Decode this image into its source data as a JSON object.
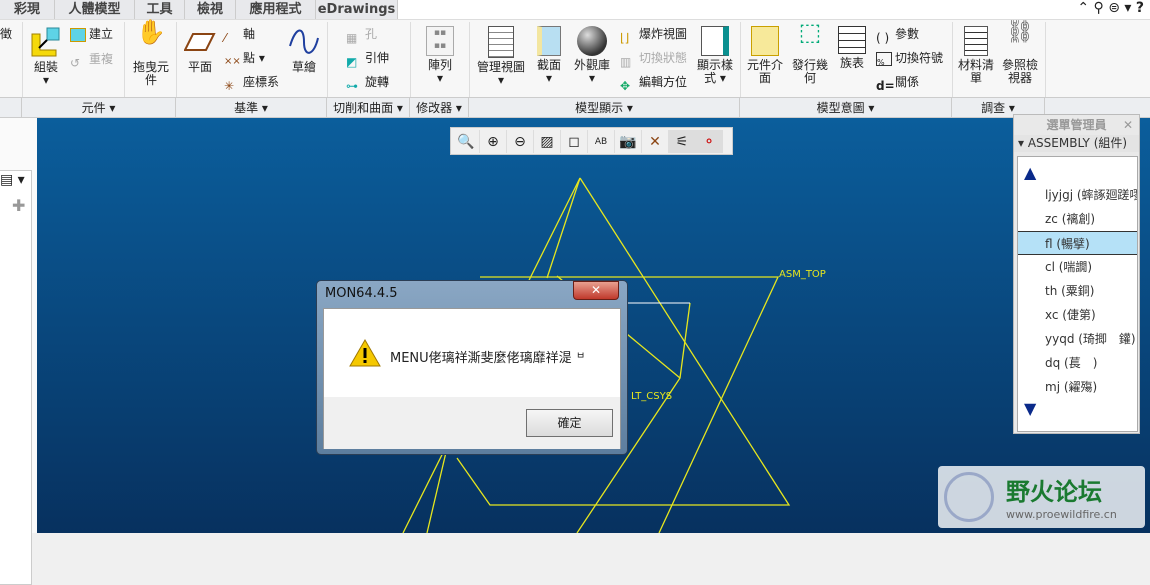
{
  "tabs": [
    "彩現",
    "人體模型",
    "工具",
    "檢視",
    "應用程式",
    "eDrawings"
  ],
  "partial_left_label": "徵",
  "ribbon": {
    "assemble": "組裝",
    "create": "建立",
    "repeat": "重複",
    "drag": "拖曳元件",
    "plane": "平面",
    "axis": "軸",
    "point": "點",
    "csys": "座標系",
    "sketch": "草繪",
    "hole": "孔",
    "extrude": "引伸",
    "revolve": "旋轉",
    "pattern": "陣列",
    "manage_views": "管理視圖",
    "section": "截面",
    "appearance": "外觀庫",
    "explode": "爆炸視圖",
    "toggle_status": "切換狀態",
    "edit_position": "編輯方位",
    "display_style": "顯示樣式",
    "component_interface": "元件介面",
    "publish_geometry": "發行幾何",
    "family_table": "族表",
    "parameters": "參數",
    "switch_symbols": "切換符號",
    "relations": "關係",
    "bom": "材料清單",
    "reference_viewer": "參照檢視器"
  },
  "groups": [
    "元件",
    "基準",
    "切削和曲面",
    "修改器",
    "模型顯示",
    "模型意圖",
    "調查"
  ],
  "graphics": {
    "labels": [
      "ASM_TOP",
      "LT_CSYS"
    ],
    "line_color": "#e6e61e"
  },
  "dialog": {
    "title": "MON64.4.5",
    "message": "MENU佬璃祥澌斐麼佬璃靡祥湜",
    "suffix": "ㅂ",
    "ok": "確定"
  },
  "menu_manager": {
    "title": "選單管理員",
    "header": "ASSEMBLY (組件)",
    "items": [
      "ljyjgj (蟀諑廻蹉嘐",
      "zc (褵創)",
      "fl (暢擘)",
      "cl (喘譋)",
      "th (粟銅)",
      "xc (倢第)",
      "yyqd (琦揤　鑵)",
      "dq (萇　)",
      "mj (糴殤)"
    ],
    "selected": 2
  },
  "watermark": {
    "name": "野火论坛",
    "url": "www.proewildfire.cn"
  }
}
